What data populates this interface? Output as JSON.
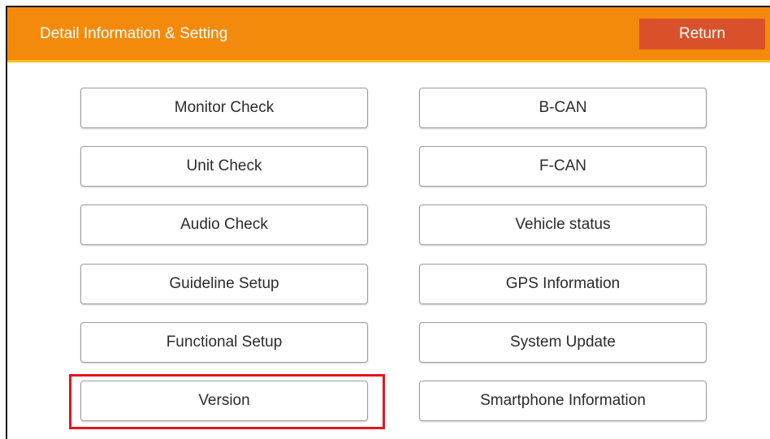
{
  "header": {
    "title": "Detail Information & Setting",
    "return_label": "Return"
  },
  "menu": {
    "left": [
      {
        "label": "Monitor Check"
      },
      {
        "label": "Unit Check"
      },
      {
        "label": "Audio Check"
      },
      {
        "label": "Guideline Setup"
      },
      {
        "label": "Functional Setup"
      },
      {
        "label": "Version"
      }
    ],
    "right": [
      {
        "label": "B-CAN"
      },
      {
        "label": "F-CAN"
      },
      {
        "label": "Vehicle status"
      },
      {
        "label": "GPS Information"
      },
      {
        "label": "System Update"
      },
      {
        "label": "Smartphone Information"
      }
    ]
  },
  "colors": {
    "header_bg": "#f48a0b",
    "header_underline": "#f7c21d",
    "return_button_bg": "#d9512a",
    "highlight": "#e8141c"
  }
}
